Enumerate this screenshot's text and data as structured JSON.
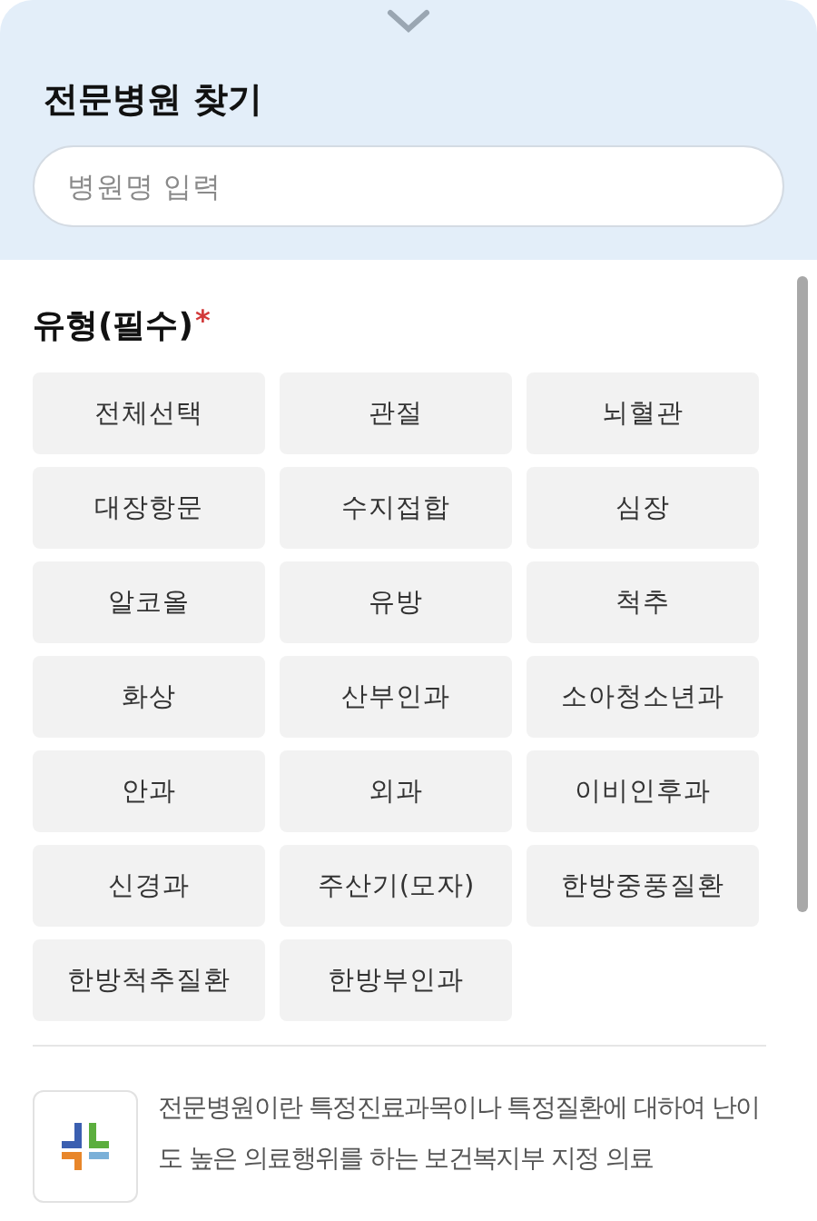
{
  "sheet": {
    "title": "전문병원 찾기",
    "search": {
      "placeholder": "병원명 입력"
    }
  },
  "types": {
    "label": "유형(필수)",
    "required_mark": "*",
    "options": [
      {
        "label": "전체선택",
        "selected": false
      },
      {
        "label": "관절",
        "selected": false
      },
      {
        "label": "뇌혈관",
        "selected": false
      },
      {
        "label": "대장항문",
        "selected": false
      },
      {
        "label": "수지접합",
        "selected": false
      },
      {
        "label": "심장",
        "selected": false
      },
      {
        "label": "알코올",
        "selected": false
      },
      {
        "label": "유방",
        "selected": false
      },
      {
        "label": "척추",
        "selected": false
      },
      {
        "label": "화상",
        "selected": false
      },
      {
        "label": "산부인과",
        "selected": false
      },
      {
        "label": "소아청소년과",
        "selected": false
      },
      {
        "label": "안과",
        "selected": false
      },
      {
        "label": "외과",
        "selected": false
      },
      {
        "label": "이비인후과",
        "selected": false
      },
      {
        "label": "신경과",
        "selected": false
      },
      {
        "label": "주산기(모자)",
        "selected": false
      },
      {
        "label": "한방중풍질환",
        "selected": false
      },
      {
        "label": "한방척추질환",
        "selected": false
      },
      {
        "label": "한방부인과",
        "selected": false
      }
    ]
  },
  "info": {
    "text": "전문병원이란 특정진료과목이나 특정질환에 대하여 난이도 높은 의료행위를 하는 보건복지부 지정 의료"
  }
}
